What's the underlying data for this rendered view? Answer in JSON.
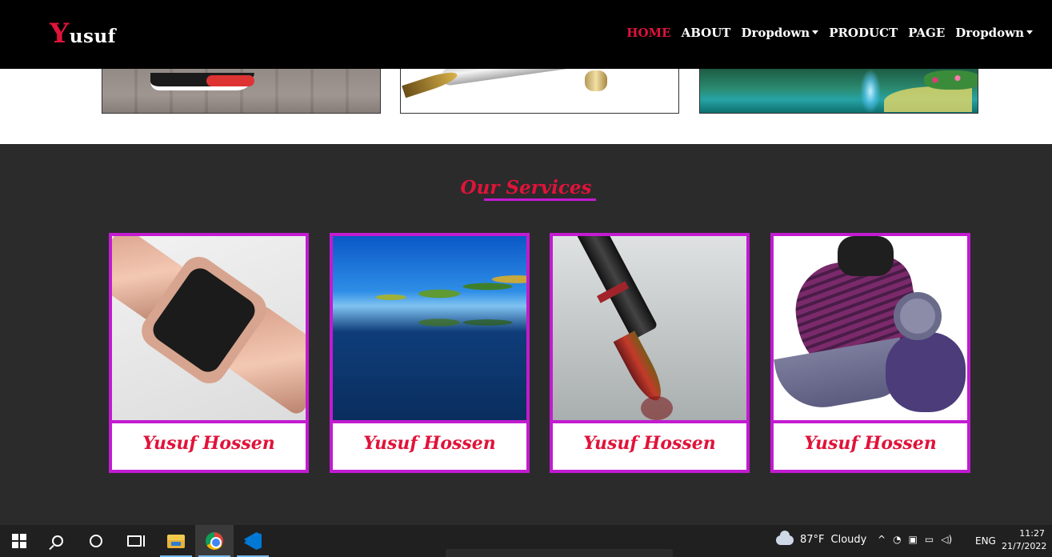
{
  "navbar": {
    "brand_first": "Y",
    "brand_rest": "usuf",
    "items": [
      {
        "label": "HOME",
        "active": true
      },
      {
        "label": "ABOUT"
      },
      {
        "label": "Dropdown",
        "caret": true
      },
      {
        "label": "PRODUCT"
      },
      {
        "label": "PAGE"
      },
      {
        "label": "Dropdown",
        "caret": true
      }
    ]
  },
  "top_strip": {
    "images": [
      "shoe-image",
      "pen-image",
      "lake-image"
    ]
  },
  "services": {
    "title": "Our Services",
    "cards": [
      {
        "image": "watch-image",
        "label": "Yusuf Hossen"
      },
      {
        "image": "lake-image",
        "label": "Yusuf Hossen"
      },
      {
        "image": "pen-image",
        "label": "Yusuf Hossen"
      },
      {
        "image": "shoe-image",
        "label": "Yusuf Hossen"
      }
    ]
  },
  "taskbar": {
    "weather_temp": "87°F",
    "weather_desc": "Cloudy",
    "language": "ENG",
    "time": "11:27",
    "date": "21/7/2022"
  },
  "colors": {
    "accent_red": "#e0133a",
    "card_border": "#c21bd1",
    "section_bg": "#2b2b2b",
    "navbar_bg": "#000000"
  }
}
